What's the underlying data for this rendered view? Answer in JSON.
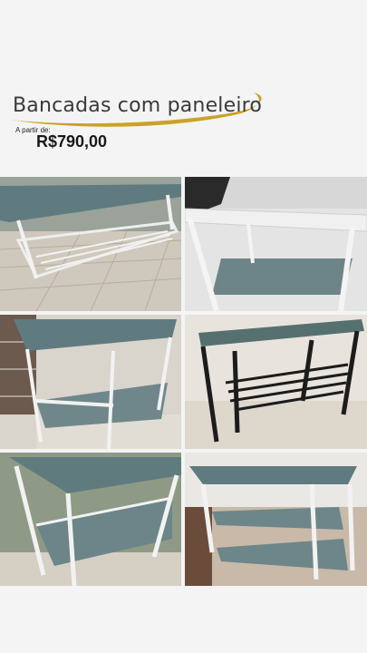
{
  "post": {
    "title": "Bancadas com paneleiro",
    "from_label": "A partir de:",
    "price": "R$790,00"
  },
  "colors": {
    "gold": "#c9a227",
    "steel": "#5f7b80",
    "white_frame": "#f2f2f2",
    "black_frame": "#1c1c1c"
  },
  "photos": [
    {
      "name": "photo-workbench-1"
    },
    {
      "name": "photo-workbench-2"
    },
    {
      "name": "photo-workbench-3"
    },
    {
      "name": "photo-workbench-4"
    },
    {
      "name": "photo-workbench-5"
    },
    {
      "name": "photo-workbench-6"
    }
  ]
}
